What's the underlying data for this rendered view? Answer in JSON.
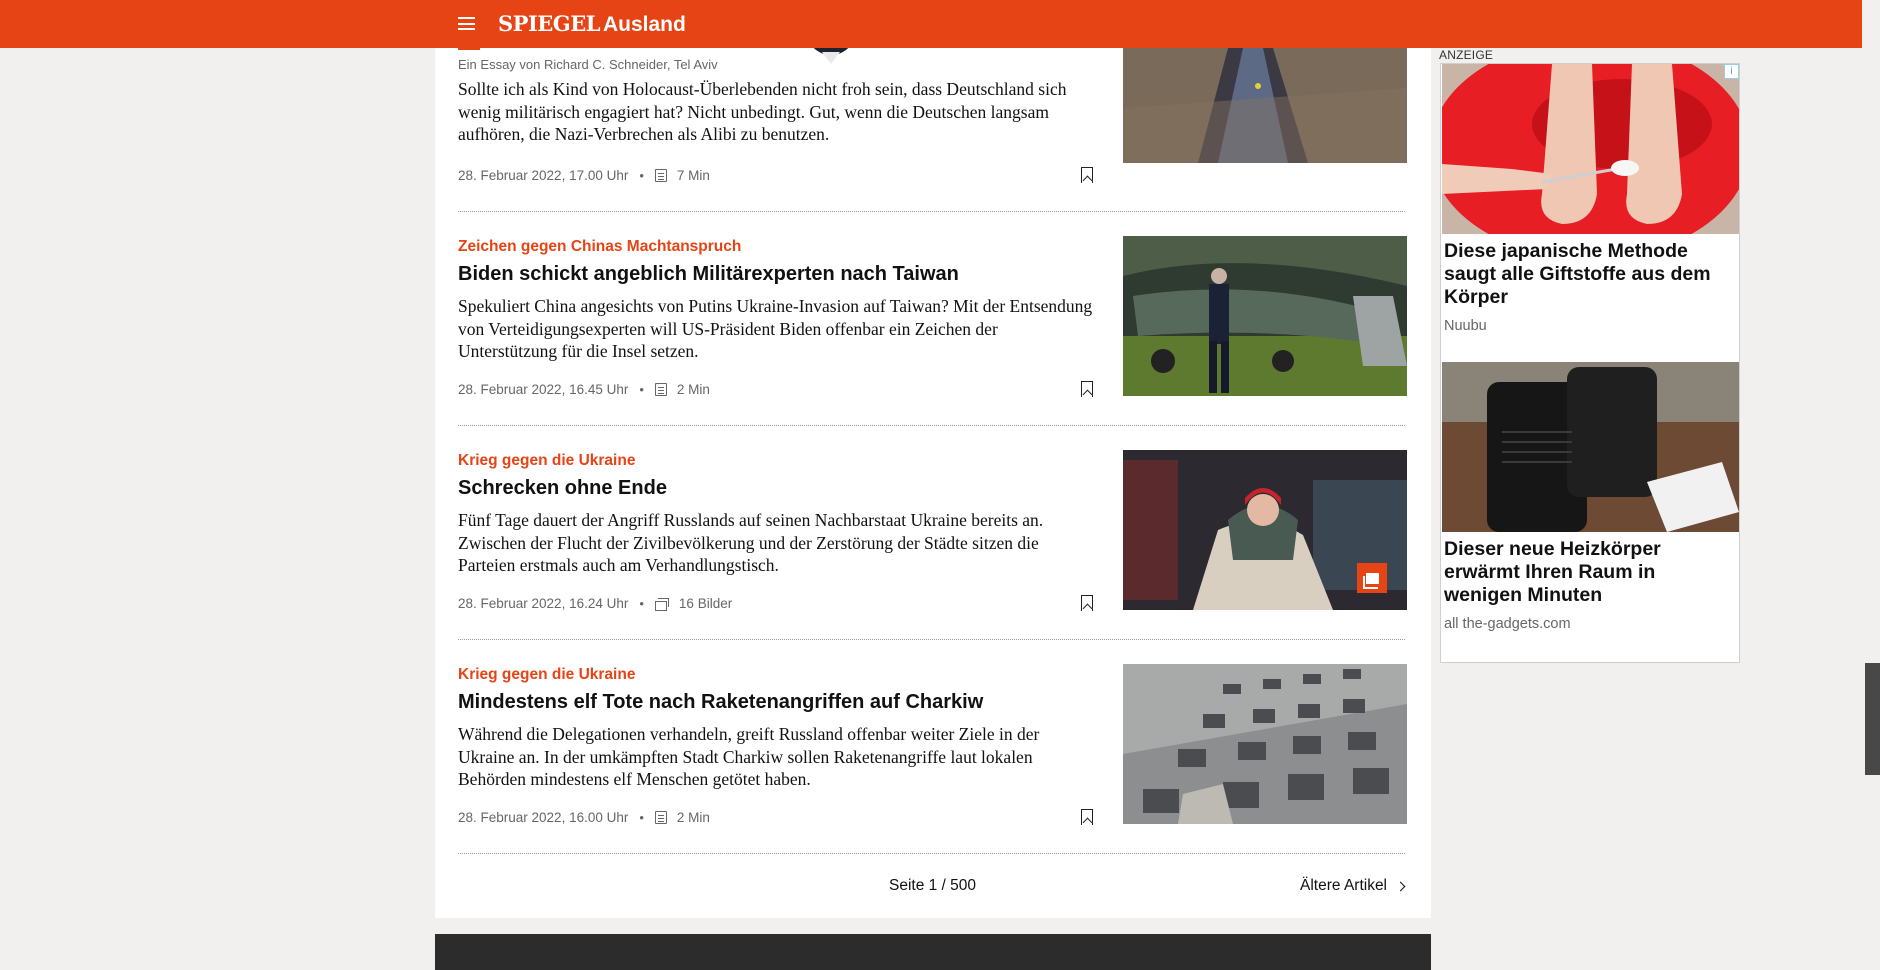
{
  "header": {
    "logo": "SPIEGEL",
    "section": "Ausland",
    "bg_color": "#e64415"
  },
  "articles": [
    {
      "author_line": "Ein Essay von Richard C. Schneider, Tel Aviv",
      "teaser": "Sollte ich als Kind von Holocaust-Überlebenden nicht froh sein, dass Deutschland sich wenig militärisch engagiert hat? Nicht unbedingt. Gut, wenn die Deutschen langsam aufhören, die Nazi-Verbrechen als Alibi zu benutzen.",
      "date": "28. Februar 2022, 17.00 Uhr",
      "meta_icon": "article-icon",
      "meta_value": "7 Min"
    },
    {
      "kicker": "Zeichen gegen Chinas Machtanspruch",
      "headline": "Biden schickt angeblich Militärexperten nach Taiwan",
      "teaser": "Spekuliert China angesichts von Putins Ukraine-Invasion auf Taiwan? Mit der Entsendung von Verteidigungsexperten will US-Präsident Biden offenbar ein Zeichen der Unterstützung für die Insel setzen.",
      "date": "28. Februar 2022, 16.45 Uhr",
      "meta_icon": "article-icon",
      "meta_value": "2 Min"
    },
    {
      "kicker": "Krieg gegen die Ukraine",
      "headline": "Schrecken ohne Ende",
      "teaser": "Fünf Tage dauert der Angriff Russlands auf seinen Nachbarstaat Ukraine bereits an. Zwischen der Flucht der Zivilbevölkerung und der Zerstörung der Städte sitzen die Parteien erstmals auch am Verhandlungstisch.",
      "date": "28. Februar 2022, 16.24 Uhr",
      "meta_icon": "gallery-icon",
      "meta_value": "16 Bilder"
    },
    {
      "kicker": "Krieg gegen die Ukraine",
      "headline": "Mindestens elf Tote nach Raketenangriffen auf Charkiw",
      "teaser": "Während die Delegationen verhandeln, greift Russland offenbar weiter Ziele in der Ukraine an. In der umkämpften Stadt Charkiw sollen Raketenangriffe laut lokalen Behörden mindestens elf Menschen getötet haben.",
      "date": "28. Februar 2022, 16.00 Uhr",
      "meta_icon": "article-icon",
      "meta_value": "2 Min"
    }
  ],
  "pagination": {
    "page": "Seite 1 / 500",
    "next": "Ältere Artikel"
  },
  "ad": {
    "label": "ANZEIGE",
    "choice": "i",
    "items": [
      {
        "title": "Diese japanische Methode saugt alle Giftstoffe aus dem Körper",
        "source": "Nuubu"
      },
      {
        "title": "Dieser neue Heizkörper erwärmt Ihren Raum in wenigen Minuten",
        "source": "all the-gadgets.com"
      }
    ]
  }
}
